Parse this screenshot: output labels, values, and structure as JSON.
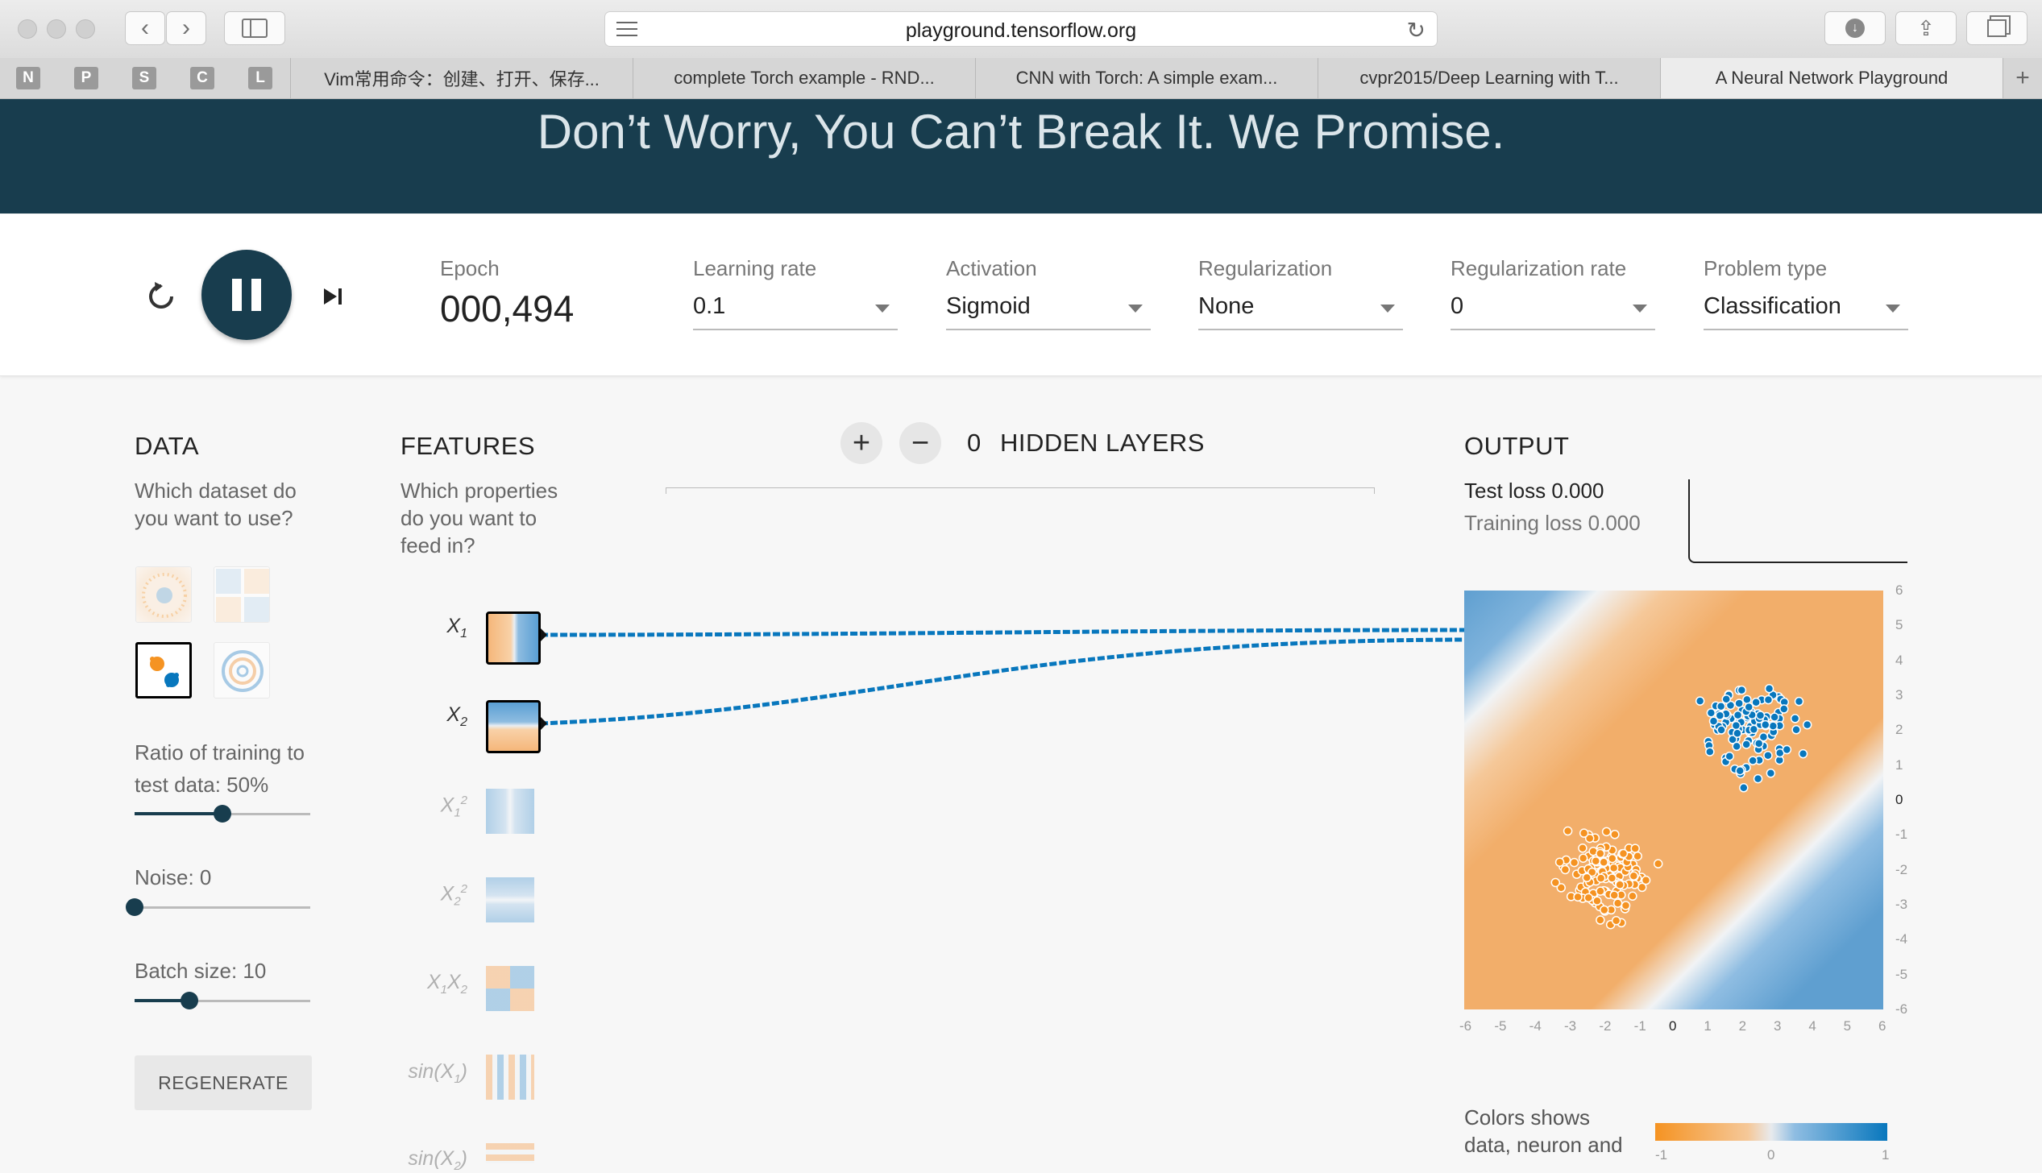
{
  "browser": {
    "url": "playground.tensorflow.org",
    "bookmarks": [
      "N",
      "P",
      "S",
      "C",
      "L"
    ],
    "tabs": [
      {
        "label": "Vim常用命令：创建、打开、保存..."
      },
      {
        "label": "complete Torch example - RND..."
      },
      {
        "label": "CNN with Torch: A simple exam..."
      },
      {
        "label": "cvpr2015/Deep Learning with T..."
      },
      {
        "label": "A Neural Network Playground"
      }
    ],
    "new_tab_label": "+"
  },
  "hero": {
    "title": "Don’t Worry, You Can’t Break It. We Promise."
  },
  "controls": {
    "epoch_label": "Epoch",
    "epoch_value": "000,494",
    "learning_rate": {
      "label": "Learning rate",
      "value": "0.1"
    },
    "activation": {
      "label": "Activation",
      "value": "Sigmoid"
    },
    "regularization": {
      "label": "Regularization",
      "value": "None"
    },
    "regularization_rate": {
      "label": "Regularization rate",
      "value": "0"
    },
    "problem_type": {
      "label": "Problem type",
      "value": "Classification"
    }
  },
  "data": {
    "title": "DATA",
    "subtitle_1": "Which dataset do",
    "subtitle_2": "you want to use?",
    "ratio_label_1": "Ratio of training to",
    "ratio_label_2": "test data:  50%",
    "ratio_value": 0.5,
    "noise_label": "Noise:  0",
    "noise_value": 0,
    "batch_label": "Batch size:  10",
    "batch_value": 10,
    "regenerate": "REGENERATE"
  },
  "features": {
    "title": "FEATURES",
    "subtitle_1": "Which properties",
    "subtitle_2": "do you want to",
    "subtitle_3": "feed in?"
  },
  "network": {
    "hidden_count": "0",
    "hidden_label": "HIDDEN LAYERS",
    "add": "+",
    "remove": "−"
  },
  "output": {
    "title": "OUTPUT",
    "test_loss": "Test loss 0.000",
    "training_loss": "Training loss 0.000",
    "legend_1": "Colors shows",
    "legend_2": "data, neuron and",
    "legend_ticks": [
      "-1",
      "0",
      "1"
    ],
    "y_ticks": [
      "6",
      "5",
      "4",
      "3",
      "2",
      "1",
      "0",
      "-1",
      "-2",
      "-3",
      "-4",
      "-5",
      "-6"
    ],
    "x_ticks": [
      "-6",
      "-5",
      "-4",
      "-3",
      "-2",
      "-1",
      "0",
      "1",
      "2",
      "3",
      "4",
      "5",
      "6"
    ]
  },
  "colors": {
    "accent": "#183d4e",
    "blue": "#0877bd",
    "orange": "#f59322"
  }
}
